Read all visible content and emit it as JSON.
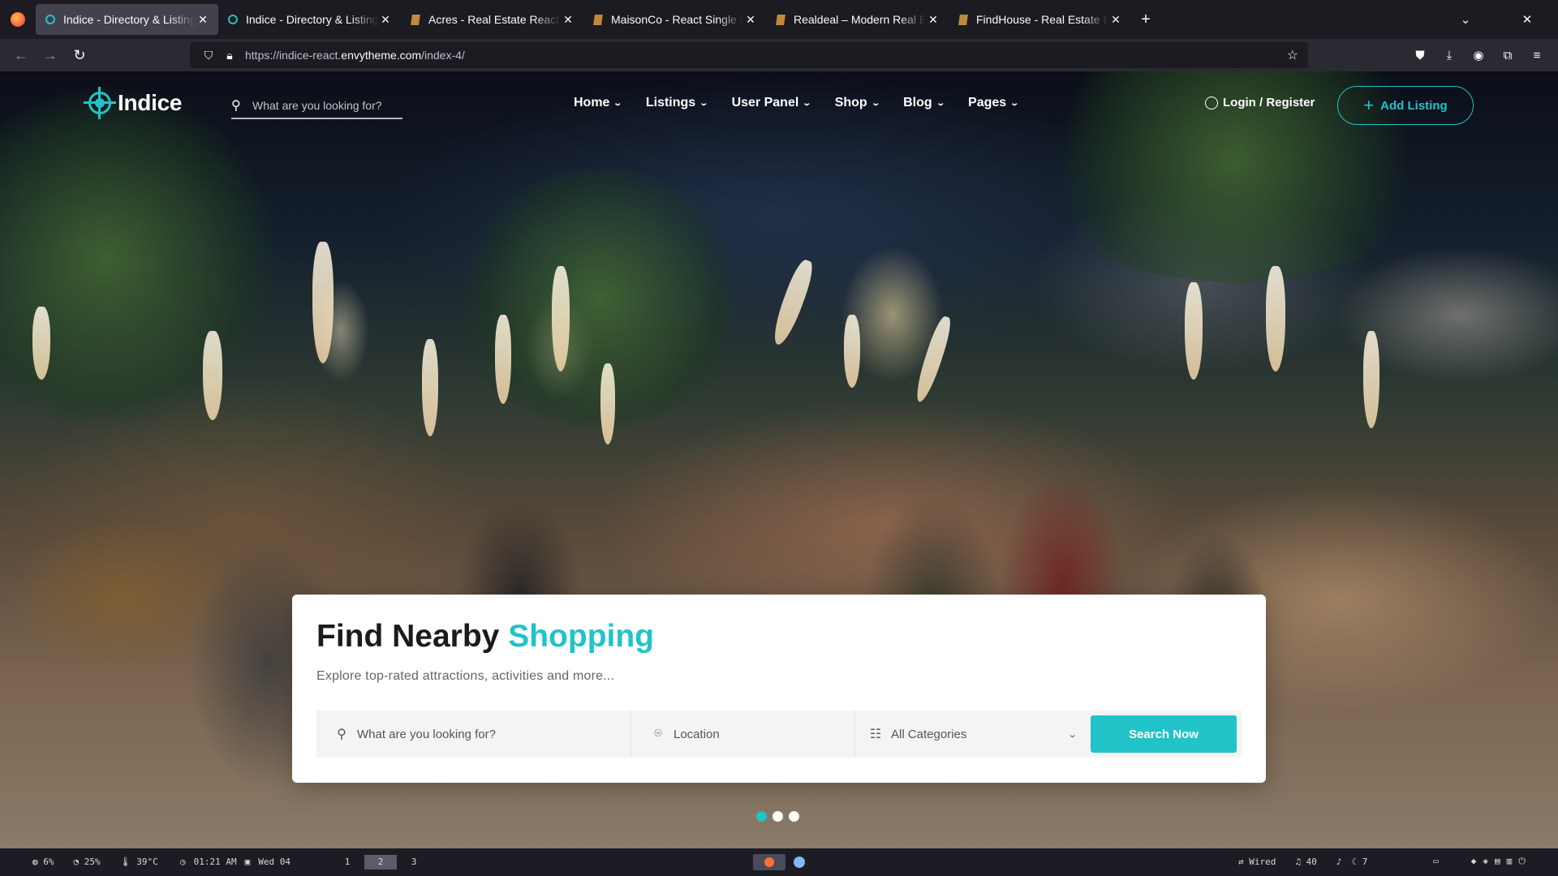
{
  "browser": {
    "tabs": [
      {
        "title": "Indice - Directory & Listing R",
        "favicon": "indice-icon",
        "active": true
      },
      {
        "title": "Indice - Directory & Listing R",
        "favicon": "indice-icon",
        "active": false
      },
      {
        "title": "Acres - Real Estate React Te",
        "favicon": "document-icon",
        "active": false
      },
      {
        "title": "MaisonCo - React Single Pro",
        "favicon": "document-icon",
        "active": false
      },
      {
        "title": "Realdeal – Modern Real Esta",
        "favicon": "document-icon",
        "active": false
      },
      {
        "title": "FindHouse - Real Estate Rea",
        "favicon": "document-icon",
        "active": false
      }
    ],
    "url_prefix": "https://indice-react.",
    "url_domain": "envytheme.com",
    "url_path": "/index-4/"
  },
  "site": {
    "logo_text": "Indice",
    "header_search_placeholder": "What are you looking for?",
    "menu": [
      {
        "label": "Home"
      },
      {
        "label": "Listings"
      },
      {
        "label": "User Panel"
      },
      {
        "label": "Shop"
      },
      {
        "label": "Blog"
      },
      {
        "label": "Pages"
      }
    ],
    "login_label": "Login / Register",
    "add_listing_label": "Add Listing"
  },
  "hero": {
    "title_plain": "Find Nearby ",
    "title_accent": "Shopping",
    "subtitle": "Explore top-rated attractions, activities and more...",
    "what_placeholder": "What are you looking for?",
    "location_placeholder": "Location",
    "category_selected": "All Categories",
    "search_button": "Search Now",
    "slides_total": 3,
    "slide_active": 1
  },
  "colors": {
    "accent": "#21c3c8",
    "card_bg": "#ffffff",
    "title_dark": "#1b1b1b"
  },
  "statusbar": {
    "cpu": "6%",
    "mem": "25%",
    "temp": "39°C",
    "time": "01:21 AM",
    "date": "Wed 04",
    "workspaces": [
      "1",
      "2",
      "3"
    ],
    "active_workspace": "2",
    "network": "Wired",
    "volume": "40",
    "brightness": "7"
  }
}
